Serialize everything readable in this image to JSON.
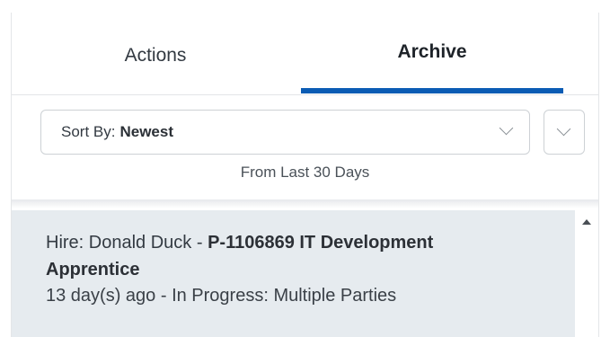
{
  "tabs": {
    "actions_label": "Actions",
    "archive_label": "Archive",
    "active": "Archive",
    "accent_color": "#0b5cb4"
  },
  "sort": {
    "prefix": "Sort By:",
    "value": "Newest",
    "range_note": "From Last 30 Days"
  },
  "items": [
    {
      "title_prefix": "Hire: Donald Duck - ",
      "title_rest": "P-1106869 IT Development Apprentice",
      "subtitle": "13 day(s) ago - In Progress: Multiple Parties"
    }
  ],
  "icons": {
    "sort_chevron": "chevron-down-icon",
    "scroll_up": "triangle-up-icon"
  }
}
